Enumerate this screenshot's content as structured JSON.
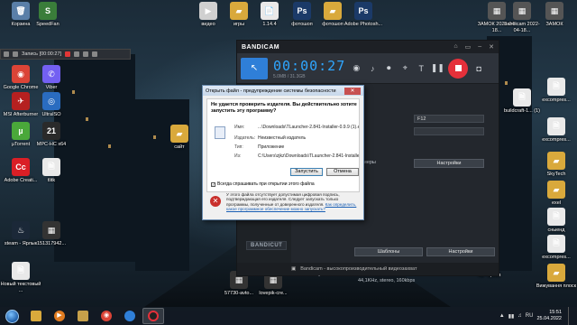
{
  "desktop": {
    "icons": [
      {
        "label": "Корзина",
        "glyph": "🗑",
        "color": "#5a7fa8"
      },
      {
        "label": "SpeedFan",
        "glyph": "S",
        "color": "#3a7d3a"
      },
      {
        "label": "видео",
        "glyph": "▶",
        "color": "#d0d0d0"
      },
      {
        "label": "игры",
        "glyph": "▰",
        "color": "#d9a93c"
      },
      {
        "label": "1.14.4",
        "glyph": "📄",
        "color": "#e9e9e9"
      },
      {
        "label": "фотошоп",
        "glyph": "Ps",
        "color": "#1b3a68"
      },
      {
        "label": "фотошоп",
        "glyph": "▰",
        "color": "#d9a93c"
      },
      {
        "label": "Adobe Photosh...",
        "glyph": "Ps",
        "color": "#1b3a68"
      },
      {
        "label": "ЗАМОК 2022-04-18...",
        "glyph": "▦",
        "color": "#555"
      },
      {
        "label": "bandicam 2022-04-18...",
        "glyph": "▦",
        "color": "#555"
      },
      {
        "label": "ЗАМОК",
        "glyph": "▦",
        "color": "#555"
      },
      {
        "label": "Google Chrome",
        "glyph": "◉",
        "color": "#db4437"
      },
      {
        "label": "Viber",
        "glyph": "✆",
        "color": "#7360f2"
      },
      {
        "label": "MSI Afterburner",
        "glyph": "✈",
        "color": "#b52020"
      },
      {
        "label": "UltraISO",
        "glyph": "◎",
        "color": "#2a6cc0"
      },
      {
        "label": "µTorrent",
        "glyph": "µ",
        "color": "#4aa83a"
      },
      {
        "label": "MPC-HC x64",
        "glyph": "21",
        "color": "#2a2a2a"
      },
      {
        "label": "Adobe Creati...",
        "glyph": "Cc",
        "color": "#da1f26"
      },
      {
        "label": "tlitk",
        "glyph": "🗎",
        "color": "#e9e9e9"
      },
      {
        "label": "steam - Ярлык",
        "glyph": "♨",
        "color": "#1b2838"
      },
      {
        "label": "151317942...",
        "glyph": "▦",
        "color": "#333"
      },
      {
        "label": "Новый текстовый ...",
        "glyph": "🗎",
        "color": "#e9e9e9"
      },
      {
        "label": "сайт",
        "glyph": "▰",
        "color": "#d9a93c"
      },
      {
        "label": "excompres...",
        "glyph": "🗎",
        "color": "#e9e9e9"
      },
      {
        "label": "buildcraft-1... (1)",
        "glyph": "🗎",
        "color": "#e9e9e9"
      },
      {
        "label": "excompres...",
        "glyph": "🗎",
        "color": "#e9e9e9"
      },
      {
        "label": "SkyTech",
        "glyph": "▰",
        "color": "#d9a93c"
      },
      {
        "label": "exel",
        "glyph": "▰",
        "color": "#d9a93c"
      },
      {
        "label": "сныенд",
        "glyph": "🗎",
        "color": "#e9e9e9"
      },
      {
        "label": "excompres...",
        "glyph": "🗎",
        "color": "#e9e9e9"
      },
      {
        "label": "Вижування плоск",
        "glyph": "▰",
        "color": "#d9a93c"
      },
      {
        "label": "57730-avto...",
        "glyph": "▦",
        "color": "#333"
      },
      {
        "label": "lovepik-cre...",
        "glyph": "▦",
        "color": "#333"
      },
      {
        "label": "ZIP архив",
        "glyph": "▤",
        "color": "#6f4fa8"
      }
    ]
  },
  "recording_bar": {
    "text": "Запись [00:00:27]"
  },
  "bandicam": {
    "logo": "BANDICAM",
    "timer": "00:00:27",
    "size": "5.0MB / 31.3GB",
    "hotkey": "F12",
    "settings_btn": "Настройки",
    "settings_btn2": "Настройки",
    "templates_btn": "Шаблоны",
    "codec_line1": "MP3 - MPEG-1 Layer 3",
    "codec_line2": "44,1KHz, stereo, 160kbps",
    "fps_line": ", 100fps, 80q",
    "mode_label": "Rec",
    "audio_label": "Звук",
    "bandicut": "BANDICUT",
    "status": "Bandicam - высокопроизводительный видеозахват",
    "monitor_label": "меры"
  },
  "dialog": {
    "title": "Открыть файл - предупреждение системы безопасности",
    "question": "Не удается проверить издателя.   Вы действительно хотите запустить эту программу?",
    "name_key": "Имя:",
    "name_val": "...\\Downloads\\TLauncher-2.841-Installer-0.9.9 (1).exe",
    "publisher_key": "Издатель:",
    "publisher_val": "Неизвестный издатель",
    "type_key": "Тип:",
    "type_val": "Приложение",
    "from_key": "Из:",
    "from_val": "C:\\Users\\zjkz\\Downloads\\TLauncher-2.841-Installer...",
    "run_btn": "Запустить",
    "cancel_btn": "Отмена",
    "checkbox_label": "Всегда спрашивать при открытии этого файла",
    "warning_text": "У этого файла отсутствует допустимая цифровая подпись, подтверждающая его издателя. Следует запускать только программы, полученные от доверенного издателя.",
    "warning_link": "Как определить, какое программное обеспечение можно запускать?"
  },
  "taskbar": {
    "time": "15:51",
    "date": "25.04.2022",
    "lang": "RU"
  }
}
